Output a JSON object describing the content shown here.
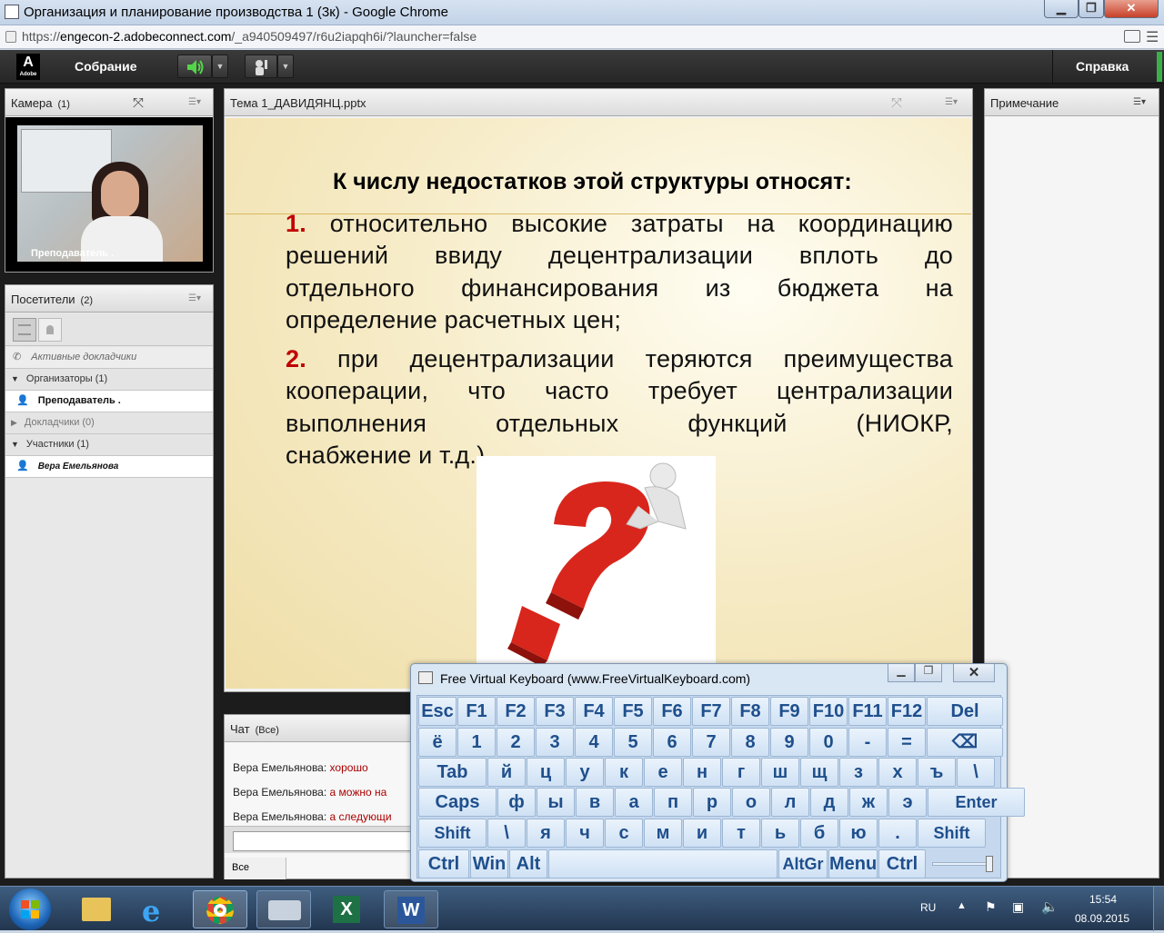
{
  "window": {
    "title": "Организация и планирование производства 1 (3к) - Google Chrome"
  },
  "addressbar": {
    "url_prefix": "https://",
    "url_domain": "engecon-2.adobeconnect.com",
    "url_path": "/_a940509497/r6u2iapqh6i/?launcher=false"
  },
  "connect": {
    "logo": "A",
    "logo_sub": "Adobe",
    "meeting_menu": "Собрание",
    "help_menu": "Справка"
  },
  "camera_pod": {
    "title": "Камера",
    "count": "(1)",
    "video_label": "Преподаватель ."
  },
  "attendees_pod": {
    "title": "Посетители",
    "count": "(2)",
    "active_speakers": "Активные докладчики",
    "hosts": "Организаторы (1)",
    "host_user": "Преподаватель .",
    "presenters": "Докладчики (0)",
    "participants": "Участники (1)",
    "participant_user": "Вера Емельянова"
  },
  "share_pod": {
    "title": "Тема 1_ДАВИДЯНЦ.pptx"
  },
  "slide": {
    "heading": "К числу недостатков этой структуры относят:",
    "item1_num": "1.",
    "item1_lines": [
      "относительно высокие затраты на координацию",
      "решений ввиду децентрализации вплоть до",
      "отдельного финансирования из бюджета на",
      "определение расчетных цен;"
    ],
    "item2_num": "2.",
    "item2_lines": [
      "при децентрализации теряются преимущества",
      "кооперации, что часто требует централизации",
      "выполнения отдельных функций (НИОКР,",
      "снабжение и т.д.)."
    ]
  },
  "notes_pod": {
    "title": "Примечание"
  },
  "chat_pod": {
    "title": "Чат",
    "scope": "(Все)",
    "footer": "Все",
    "messages": [
      {
        "sender": "Вера Емельянова:",
        "text": "хорошо"
      },
      {
        "sender": "Вера Емельянова:",
        "text": "а можно на"
      },
      {
        "sender": "Вера Емельянова:",
        "text": "а следующи"
      }
    ]
  },
  "keyboard": {
    "title": "Free Virtual Keyboard (www.FreeVirtualKeyboard.com)",
    "row1": [
      "Esc",
      "F1",
      "F2",
      "F3",
      "F4",
      "F5",
      "F6",
      "F7",
      "F8",
      "F9",
      "F10",
      "F11",
      "F12",
      "Del"
    ],
    "row2": [
      "ё",
      "1",
      "2",
      "3",
      "4",
      "5",
      "6",
      "7",
      "8",
      "9",
      "0",
      "-",
      "=",
      "⌫"
    ],
    "row3": [
      "Tab",
      "й",
      "ц",
      "у",
      "к",
      "е",
      "н",
      "г",
      "ш",
      "щ",
      "з",
      "х",
      "ъ",
      "\\"
    ],
    "row4": [
      "Caps",
      "ф",
      "ы",
      "в",
      "а",
      "п",
      "р",
      "о",
      "л",
      "д",
      "ж",
      "э",
      "Enter"
    ],
    "row5": [
      "Shift",
      "\\",
      "я",
      "ч",
      "с",
      "м",
      "и",
      "т",
      "ь",
      "б",
      "ю",
      ".",
      "Shift"
    ],
    "row6": [
      "Ctrl",
      "Win",
      "Alt",
      "",
      "AltGr",
      "Menu",
      "Ctrl"
    ]
  },
  "taskbar": {
    "lang": "RU",
    "time": "15:54",
    "date": "08.09.2015"
  }
}
